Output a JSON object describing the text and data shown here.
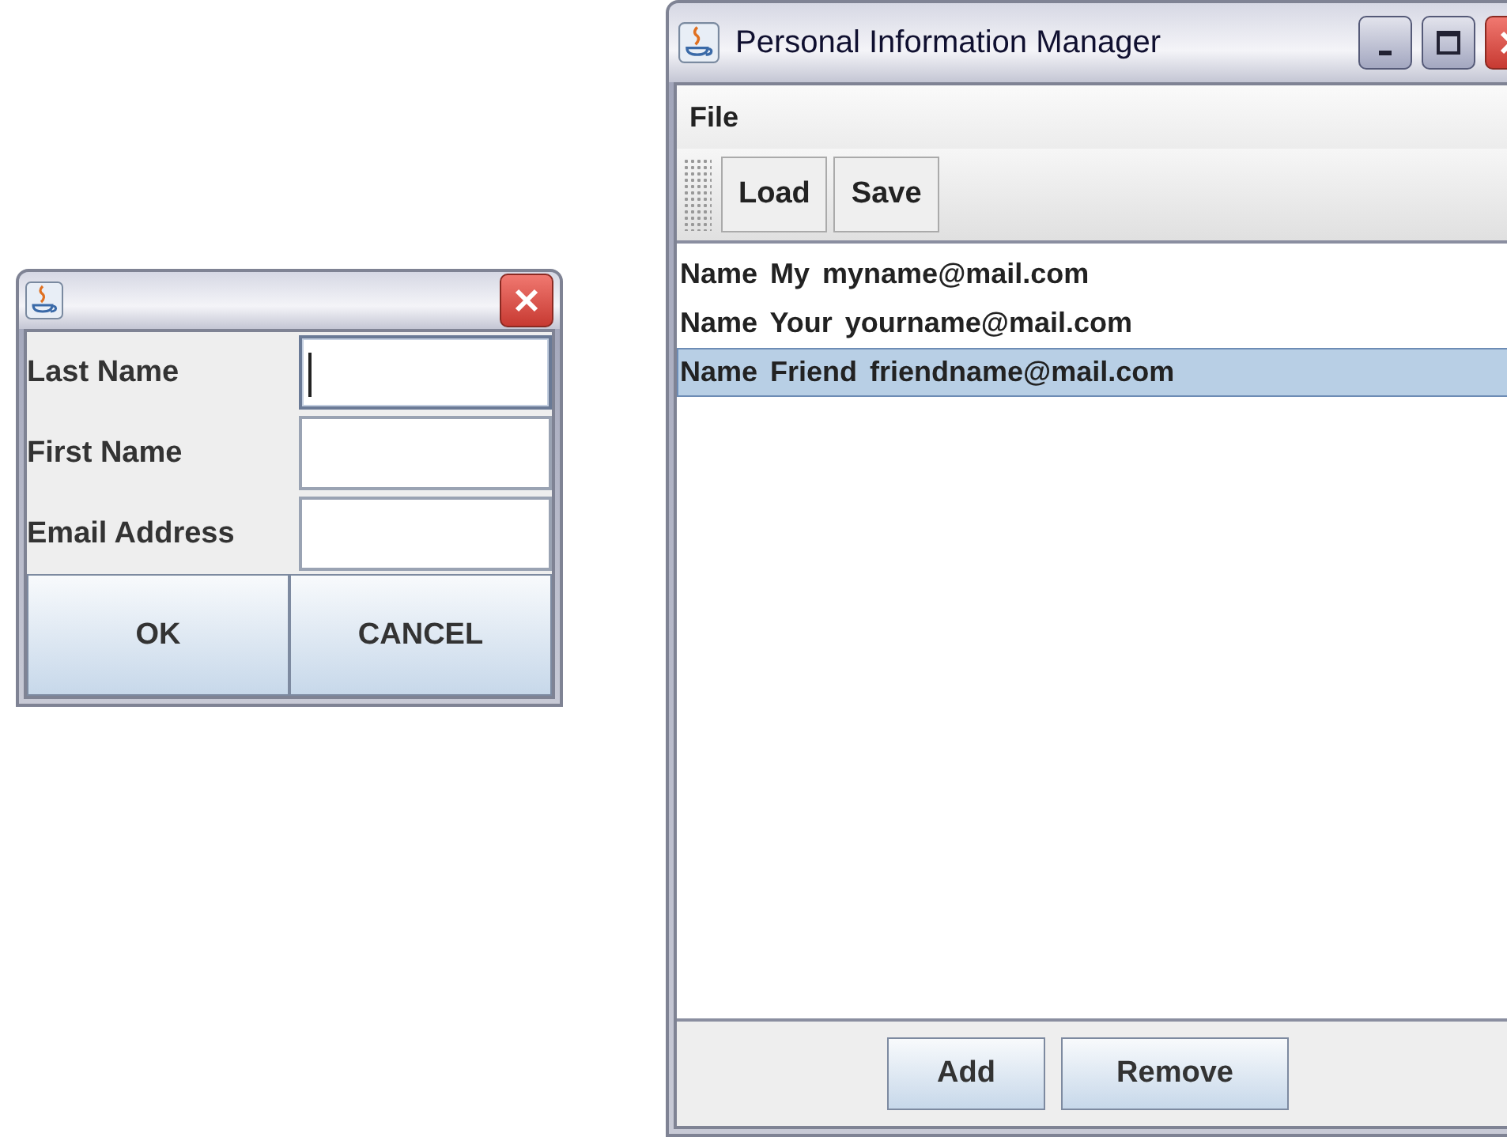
{
  "dialog": {
    "fields": [
      {
        "label": "Last Name",
        "focused": true
      },
      {
        "label": "First Name",
        "focused": false
      },
      {
        "label": "Email Address",
        "focused": false
      }
    ],
    "buttons": [
      "OK",
      "CANCEL"
    ]
  },
  "main_window": {
    "title": "Personal Information Manager",
    "menu": [
      "File"
    ],
    "toolbar": [
      "Load",
      "Save"
    ],
    "list": [
      {
        "text": "Name My myname@mail.com",
        "selected": false
      },
      {
        "text": "Name Your yourname@mail.com",
        "selected": false
      },
      {
        "text": "Name Friend friendname@mail.com",
        "selected": true
      }
    ],
    "buttons": [
      "Add",
      "Remove"
    ]
  }
}
